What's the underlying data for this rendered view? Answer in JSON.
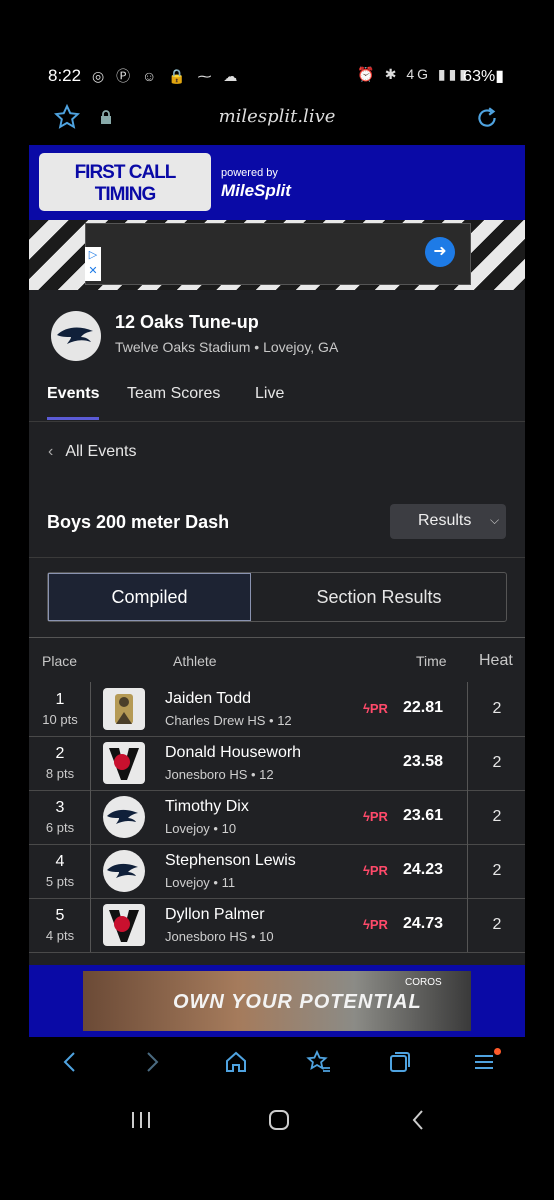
{
  "status_bar": {
    "time": "8:22",
    "left_icons": "◎ Ⓟ ☺ 🔒 ⁓ ☁",
    "right_icons": "⏰ ✱ 4G ▮▮▮",
    "battery": "63%▮"
  },
  "url_bar": {
    "site": "milesplit.live"
  },
  "top_ad": {
    "line1": "FIRST CALL",
    "line2": "TIMING",
    "powered": "powered by",
    "brand": "MileSplit"
  },
  "meet": {
    "name": "12 Oaks Tune-up",
    "location": "Twelve Oaks Stadium • Lovejoy, GA"
  },
  "tabs": [
    "Events",
    "Team Scores",
    "Live"
  ],
  "back_label": "All Events",
  "event": {
    "title": "Boys 200 meter Dash",
    "view_select": "Results"
  },
  "segments": {
    "compiled": "Compiled",
    "section": "Section Results"
  },
  "table": {
    "headers": {
      "place": "Place",
      "athlete": "Athlete",
      "time": "Time",
      "heat": "Heat"
    },
    "rows": [
      {
        "place": "1",
        "pts": "10 pts",
        "name": "Jaiden Todd",
        "school": "Charles Drew HS • 12",
        "pr": "PR",
        "time": "22.81",
        "heat": "2"
      },
      {
        "place": "2",
        "pts": "8 pts",
        "name": "Donald Houseworh",
        "school": "Jonesboro HS • 12",
        "pr": "",
        "time": "23.58",
        "heat": "2"
      },
      {
        "place": "3",
        "pts": "6 pts",
        "name": "Timothy Dix",
        "school": "Lovejoy • 10",
        "pr": "PR",
        "time": "23.61",
        "heat": "2"
      },
      {
        "place": "4",
        "pts": "5 pts",
        "name": "Stephenson Lewis",
        "school": "Lovejoy • 11",
        "pr": "PR",
        "time": "24.23",
        "heat": "2"
      },
      {
        "place": "5",
        "pts": "4 pts",
        "name": "Dyllon Palmer",
        "school": "Jonesboro HS • 10",
        "pr": "PR",
        "time": "24.73",
        "heat": "2"
      }
    ]
  },
  "bottom_ad": {
    "text": "OWN YOUR POTENTIAL",
    "brand": "COROS"
  },
  "browser_nav": [
    "back",
    "forward",
    "home",
    "bookmarks",
    "tabs",
    "menu"
  ],
  "colors": {
    "accent": "#5b5bd6",
    "pr": "#ff4a6a",
    "ad_blue": "#0a0aa6",
    "nav_icon": "#4fa3e0"
  }
}
